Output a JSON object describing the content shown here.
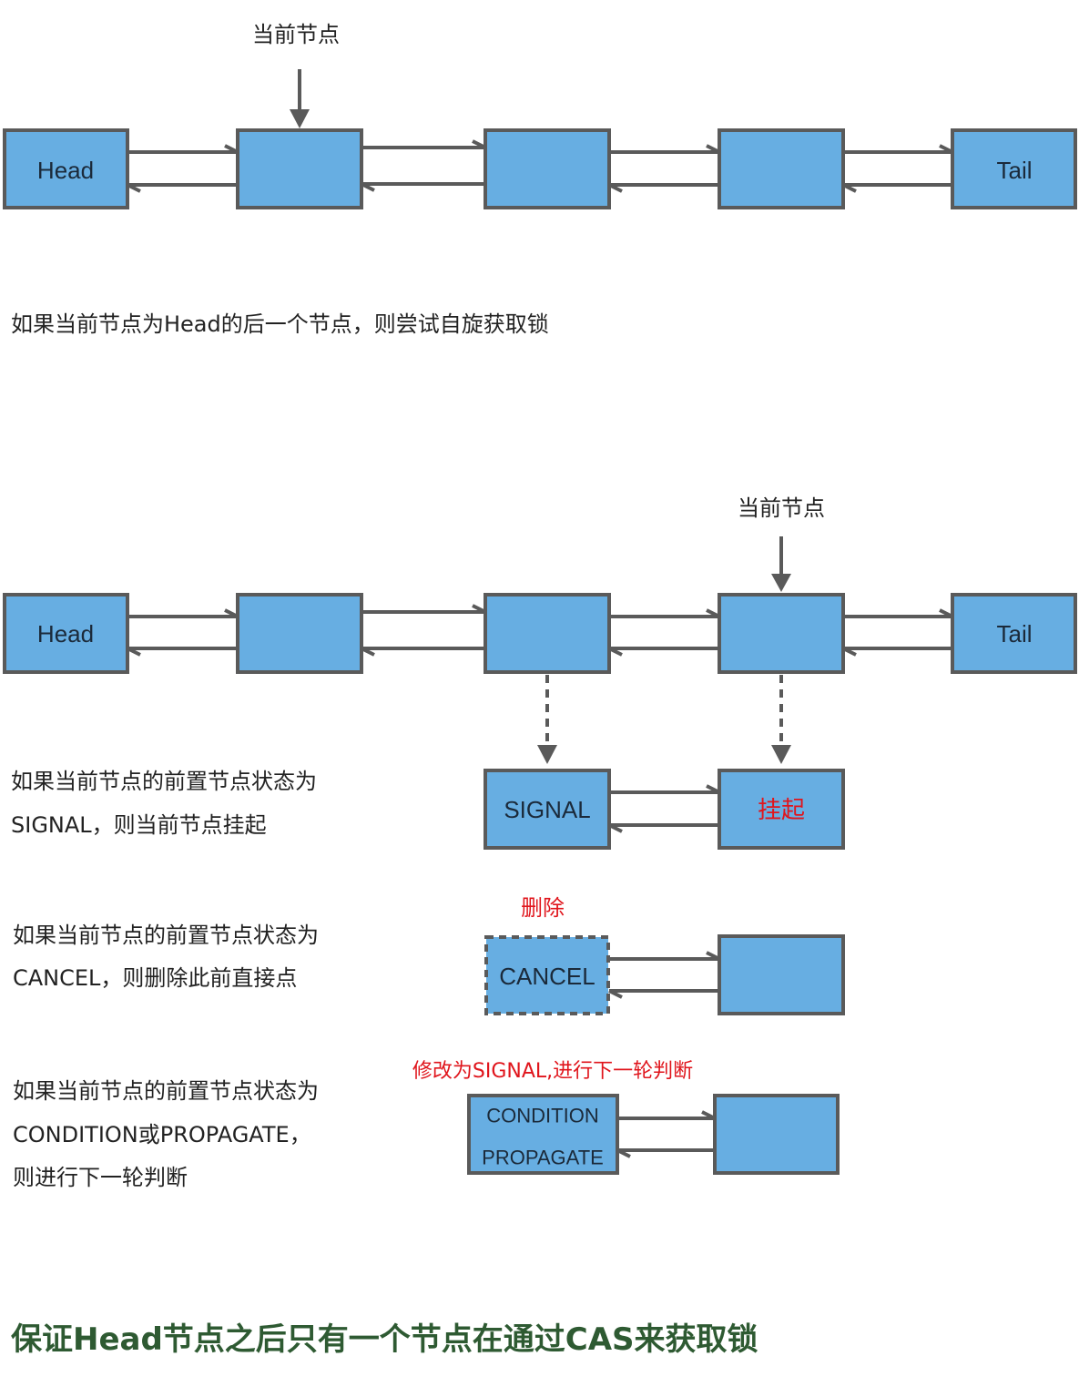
{
  "colors": {
    "node_fill": "#67aee2",
    "node_stroke": "#5a5a5a",
    "text_dark": "#1b2a3a",
    "annotation_red": "#e0151c",
    "summary_green": "#2e5a32"
  },
  "diagram1": {
    "current_label": "当前节点",
    "nodes": [
      "Head",
      "",
      "",
      "",
      "Tail"
    ],
    "current_index": 1,
    "description": "如果当前节点为Head的后一个节点，则尝试自旋获取锁"
  },
  "diagram2": {
    "current_label": "当前节点",
    "nodes": [
      "Head",
      "",
      "",
      "",
      "Tail"
    ],
    "current_index": 3
  },
  "cases": [
    {
      "desc_lines": [
        "如果当前节点的前置节点状态为",
        "SIGNAL，则当前节点挂起"
      ],
      "pred_label": "SIGNAL",
      "curr_label": "挂起",
      "annotation": ""
    },
    {
      "desc_lines": [
        "如果当前节点的前置节点状态为",
        "CANCEL，则删除此前直接点"
      ],
      "pred_label": "CANCEL",
      "curr_label": "",
      "annotation": "删除"
    },
    {
      "desc_lines": [
        "如果当前节点的前置节点状态为",
        "CONDITION或PROPAGATE，",
        "则进行下一轮判断"
      ],
      "pred_label_lines": [
        "CONDITION",
        "PROPAGATE"
      ],
      "curr_label": "",
      "annotation": "修改为SIGNAL,进行下一轮判断"
    }
  ],
  "summary": "保证Head节点之后只有一个节点在通过CAS来获取锁"
}
